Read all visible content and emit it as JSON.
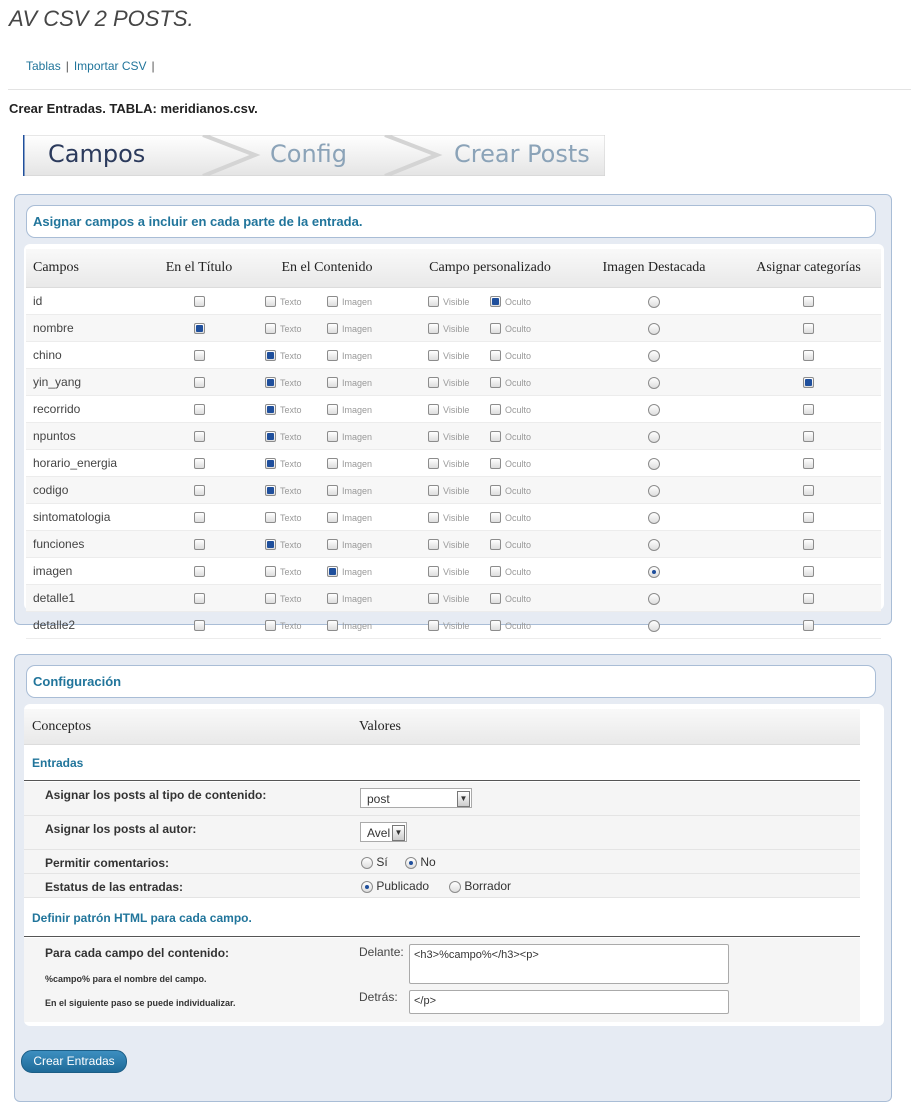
{
  "header": {
    "title": "AV CSV 2 POSTS.",
    "nav": [
      "Tablas",
      "Importar CSV"
    ],
    "nav_sep": "|",
    "lead": "Crear Entradas. TABLA: meridianos.csv."
  },
  "steps": [
    "Campos",
    "Config",
    "Crear Posts"
  ],
  "fields_panel": {
    "title": "Asignar campos a incluir en cada parte de la entrada.",
    "columns": [
      "Campos",
      "En el Título",
      "En el Contenido",
      "Campo personalizado",
      "Imagen Destacada",
      "Asignar categorías"
    ],
    "content_labels": [
      "Texto",
      "Imagen"
    ],
    "custom_labels": [
      "Visible",
      "Oculto"
    ],
    "rows": [
      {
        "name": "id",
        "title": false,
        "texto": false,
        "imagen": false,
        "visible": false,
        "oculto": true,
        "destacada": false,
        "categorias": false
      },
      {
        "name": "nombre",
        "title": true,
        "texto": false,
        "imagen": false,
        "visible": false,
        "oculto": false,
        "destacada": false,
        "categorias": false
      },
      {
        "name": "chino",
        "title": false,
        "texto": true,
        "imagen": false,
        "visible": false,
        "oculto": false,
        "destacada": false,
        "categorias": false
      },
      {
        "name": "yin_yang",
        "title": false,
        "texto": true,
        "imagen": false,
        "visible": false,
        "oculto": false,
        "destacada": false,
        "categorias": true
      },
      {
        "name": "recorrido",
        "title": false,
        "texto": true,
        "imagen": false,
        "visible": false,
        "oculto": false,
        "destacada": false,
        "categorias": false
      },
      {
        "name": "npuntos",
        "title": false,
        "texto": true,
        "imagen": false,
        "visible": false,
        "oculto": false,
        "destacada": false,
        "categorias": false
      },
      {
        "name": "horario_energia",
        "title": false,
        "texto": true,
        "imagen": false,
        "visible": false,
        "oculto": false,
        "destacada": false,
        "categorias": false
      },
      {
        "name": "codigo",
        "title": false,
        "texto": true,
        "imagen": false,
        "visible": false,
        "oculto": false,
        "destacada": false,
        "categorias": false
      },
      {
        "name": "sintomatologia",
        "title": false,
        "texto": false,
        "imagen": false,
        "visible": false,
        "oculto": false,
        "destacada": false,
        "categorias": false
      },
      {
        "name": "funciones",
        "title": false,
        "texto": true,
        "imagen": false,
        "visible": false,
        "oculto": false,
        "destacada": false,
        "categorias": false
      },
      {
        "name": "imagen",
        "title": false,
        "texto": false,
        "imagen": true,
        "visible": false,
        "oculto": false,
        "destacada": true,
        "categorias": false
      },
      {
        "name": "detalle1",
        "title": false,
        "texto": false,
        "imagen": false,
        "visible": false,
        "oculto": false,
        "destacada": false,
        "categorias": false
      },
      {
        "name": "detalle2",
        "title": false,
        "texto": false,
        "imagen": false,
        "visible": false,
        "oculto": false,
        "destacada": false,
        "categorias": false
      }
    ]
  },
  "config": {
    "title": "Configuración",
    "col_conceptos": "Conceptos",
    "col_valores": "Valores",
    "section_entradas": "Entradas",
    "post_type_label": "Asignar los posts al tipo de contenido:",
    "post_type_value": "post",
    "author_label": "Asignar los posts al autor:",
    "author_value": "Avel",
    "comments_label": "Permitir comentarios:",
    "comments_options": [
      "Sí",
      "No"
    ],
    "comments_selected": "No",
    "status_label": "Estatus de las entradas:",
    "status_options": [
      "Publicado",
      "Borrador"
    ],
    "status_selected": "Publicado",
    "section_html": "Definir patrón HTML para cada campo.",
    "html_label": "Para cada campo del contenido:",
    "html_note1": "%campo% para el nombre del campo.",
    "html_note2": "En el siguiente paso se puede individualizar.",
    "before_label": "Delante:",
    "before_value": "<h3>%campo%</h3><p>",
    "after_label": "Detrás:",
    "after_value": "</p>"
  },
  "submit_label": "Crear Entradas"
}
